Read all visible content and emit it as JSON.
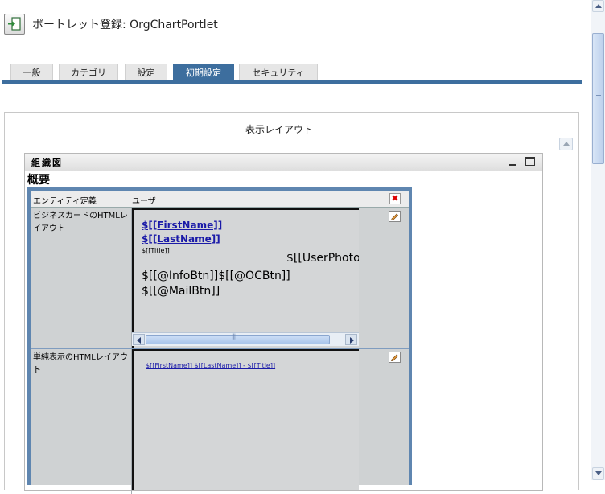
{
  "header": {
    "title": "ポートレット登録: OrgChartPortlet",
    "icon": "portlet-register-icon"
  },
  "tabs": [
    {
      "label": "一般",
      "active": false
    },
    {
      "label": "カテゴリ",
      "active": false
    },
    {
      "label": "設定",
      "active": false
    },
    {
      "label": "初期設定",
      "active": true
    },
    {
      "label": "セキュリティ",
      "active": false
    }
  ],
  "layout": {
    "title": "表示レイアウト"
  },
  "portlet": {
    "name": "組織図",
    "overview": "概要"
  },
  "settings": {
    "entity_label": "エンティティ定義",
    "entity_value": "ユーザ",
    "business_card_label": "ビジネスカードのHTMLレイアウト",
    "simple_display_label": "単純表示のHTMLレイアウト"
  },
  "business_card": {
    "first_name": "$[[FirstName]]",
    "last_name": "$[[LastName]]",
    "title": "$[[Title]]",
    "user_photo": "$[[UserPhoto",
    "info_oc_btn": "$[[@InfoBtn]]$[[@OCBtn]]",
    "mail_btn": "$[[@MailBtn]]"
  },
  "simple_display": {
    "text": "$[[FirstName]] $[[LastName]] - $[[Title]]"
  },
  "colors": {
    "accent": "#3d6e9e",
    "table_border": "#5f86b0",
    "editor_bg": "#d4d6d7",
    "link": "#1a1aa8"
  }
}
